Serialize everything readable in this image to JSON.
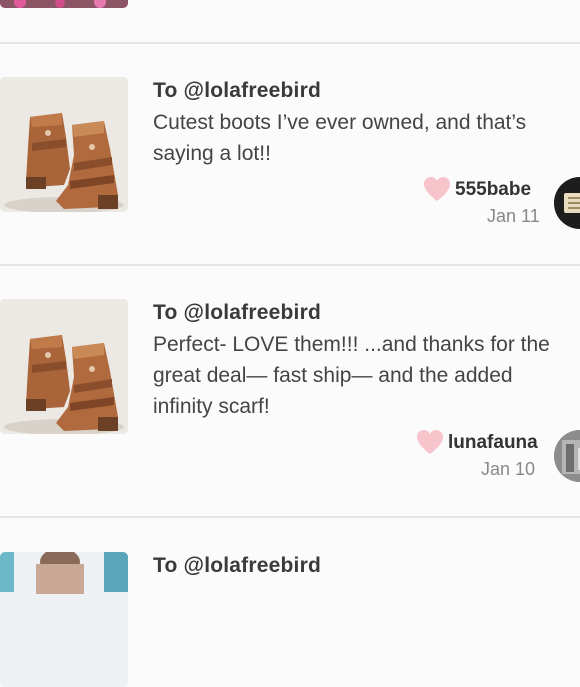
{
  "reviews": [
    {
      "recipient": "To @lolafreebird",
      "comment": "Cutest boots I’ve ever owned, and that’s\nsaying a lot!!",
      "username": "555babe",
      "date": "Jan 11",
      "liked": true,
      "icons": {
        "like": "heart-icon",
        "avatar": "user-avatar"
      }
    },
    {
      "recipient": "To @lolafreebird",
      "comment": "Perfect- LOVE them!!! ...and thanks for the\ngreat deal— fast ship— and the added\ninfinity scarf!",
      "username": "lunafauna",
      "date": "Jan 10",
      "liked": true,
      "icons": {
        "like": "heart-icon",
        "avatar": "user-avatar"
      }
    },
    {
      "recipient": "To @lolafreebird"
    }
  ],
  "colors": {
    "heart": "#f7c4cb",
    "divider": "#e5e5e5",
    "background": "#fbfbfb",
    "text_primary": "#333333",
    "text_muted": "#888888"
  }
}
